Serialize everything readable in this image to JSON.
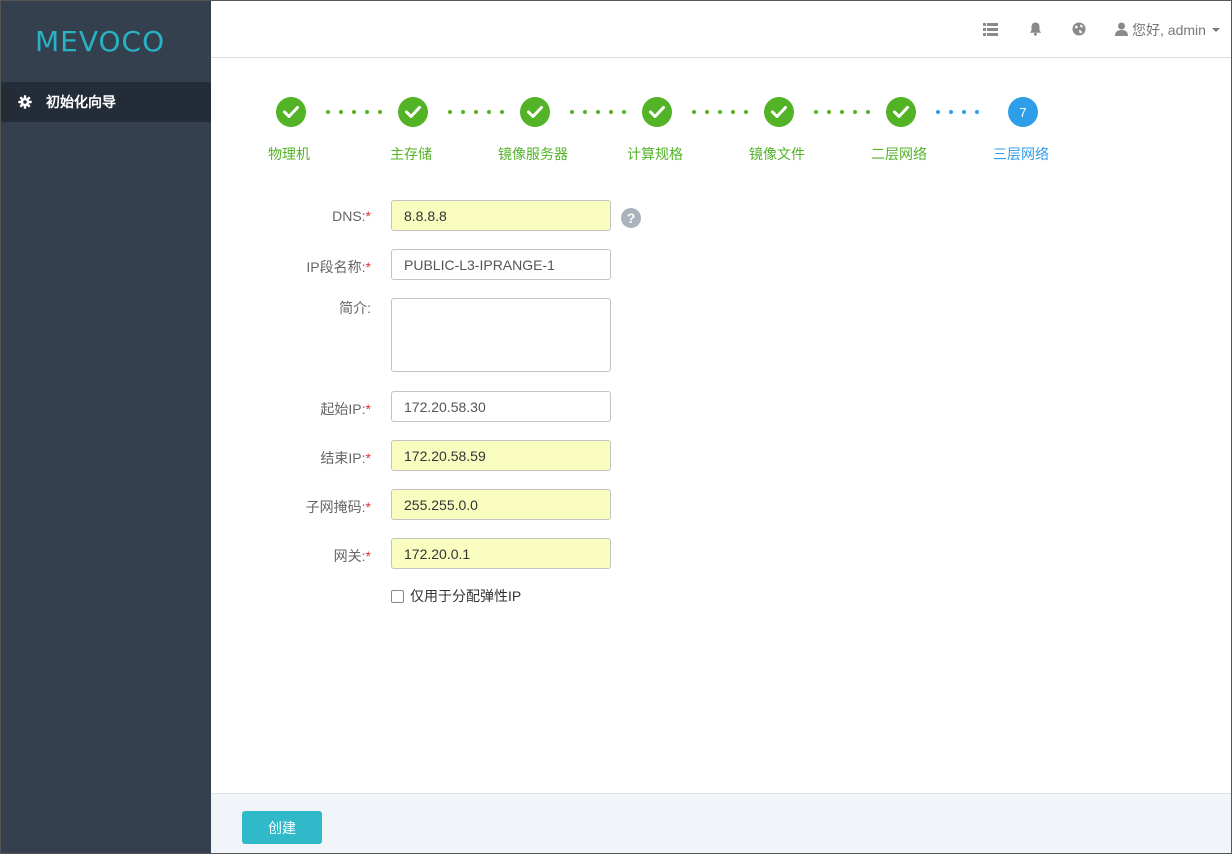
{
  "app": {
    "logo": "MEVOCO"
  },
  "sidebar": {
    "items": [
      {
        "label": "初始化向导",
        "icon": "gear-icon"
      }
    ]
  },
  "header": {
    "icons": [
      "list-icon",
      "bell-icon",
      "globe-icon",
      "user-icon"
    ],
    "user_label": "您好, admin"
  },
  "wizard": {
    "steps": [
      {
        "label": "物理机",
        "status": "done"
      },
      {
        "label": "主存储",
        "status": "done"
      },
      {
        "label": "镜像服务器",
        "status": "done"
      },
      {
        "label": "计算规格",
        "status": "done"
      },
      {
        "label": "镜像文件",
        "status": "done"
      },
      {
        "label": "二层网络",
        "status": "done"
      },
      {
        "label": "三层网络",
        "status": "active",
        "number": "7"
      }
    ],
    "colors": {
      "done": "#52b327",
      "active": "#2f9ee8"
    }
  },
  "form": {
    "dns": {
      "label": "DNS:",
      "required": "*",
      "value": "8.8.8.8"
    },
    "ip_range_name": {
      "label": "IP段名称:",
      "required": "*",
      "value": "PUBLIC-L3-IPRANGE-1"
    },
    "description": {
      "label": "简介:",
      "value": ""
    },
    "start_ip": {
      "label": "起始IP:",
      "required": "*",
      "value": "172.20.58.30"
    },
    "end_ip": {
      "label": "结束IP:",
      "required": "*",
      "value": "172.20.58.59"
    },
    "netmask": {
      "label": "子网掩码:",
      "required": "*",
      "value": "255.255.0.0"
    },
    "gateway": {
      "label": "网关:",
      "required": "*",
      "value": "172.20.0.1"
    },
    "eip_only": {
      "label": "仅用于分配弹性IP",
      "checked": false
    },
    "help_symbol": "?"
  },
  "footer": {
    "create_label": "创建"
  }
}
